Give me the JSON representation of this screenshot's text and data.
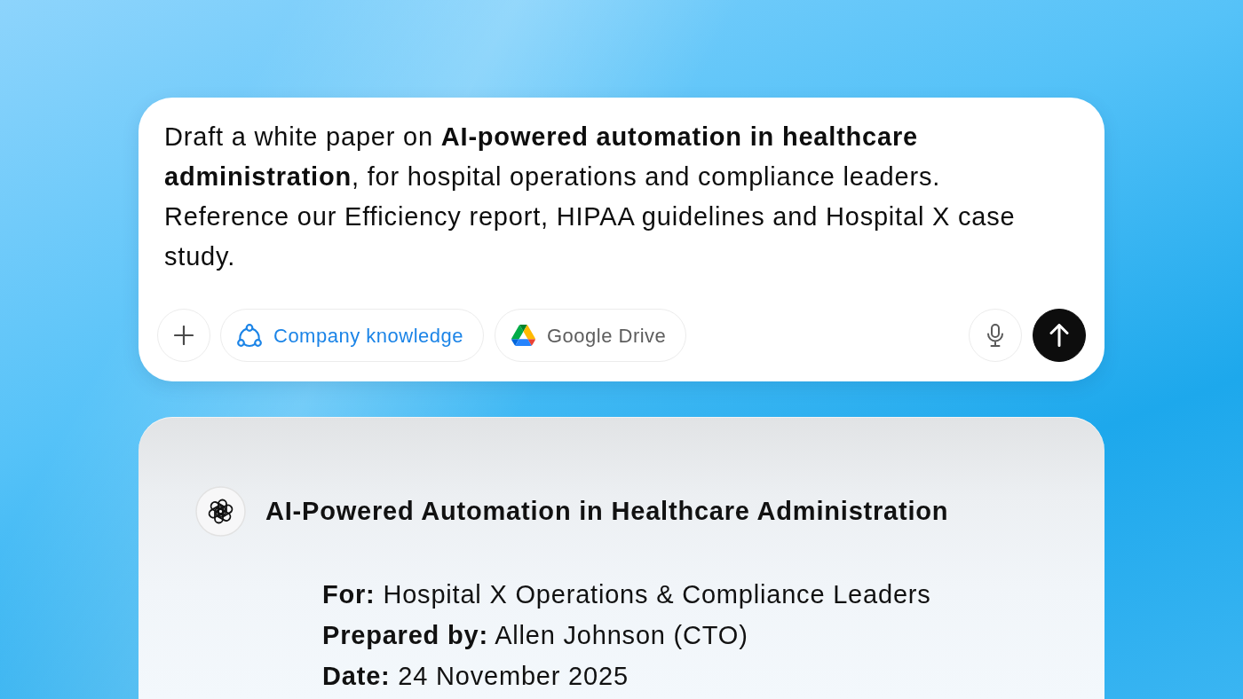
{
  "prompt": {
    "text": "Draft a white paper on **AI-powered automation in healthcare administration**, for hospital operations and compliance leaders. Reference our Efficiency report, HIPAA guidelines and Hospital X case study.",
    "chips": [
      {
        "kind": "knowledge",
        "label": "Company knowledge",
        "selected": true
      },
      {
        "kind": "drive",
        "label": "Google Drive",
        "selected": false
      }
    ]
  },
  "response": {
    "title": "AI-Powered Automation in Healthcare Administration",
    "details": [
      "**For:** Hospital X Operations & Compliance Leaders",
      "**Prepared by:** Allen Johnson (CTO)",
      "**Date:** 24 November 2025"
    ]
  }
}
